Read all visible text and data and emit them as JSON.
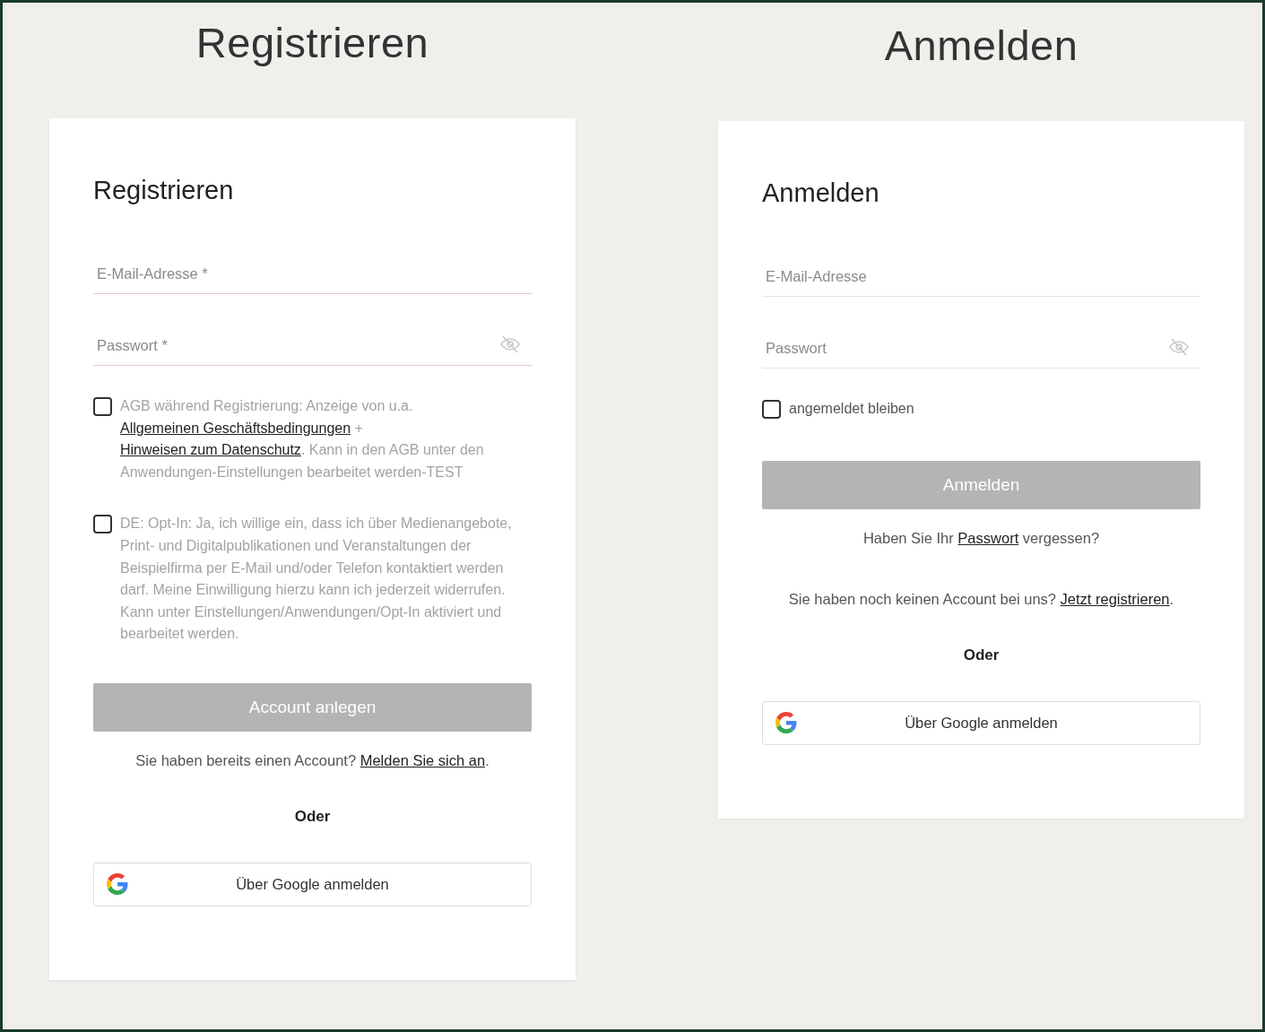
{
  "panels": [
    {
      "heading": "Registrieren",
      "card_title": "Registrieren",
      "items": [
        {
          "kind": "field",
          "placeholder": "E-Mail-Adresse *",
          "password": false,
          "invalid": true
        },
        {
          "kind": "field",
          "placeholder": "Passwort *",
          "password": true,
          "invalid": true
        },
        {
          "kind": "checkbox",
          "checked": false,
          "dark": false,
          "parts": [
            {
              "text": "AGB während Registrierung: Anzeige von u.a. ",
              "link": false
            },
            {
              "text": "Allgemeinen Geschäftsbedingungen",
              "link": true
            },
            {
              "text": " + ",
              "link": false
            },
            {
              "text": "Hinweisen zum Datenschutz",
              "link": true
            },
            {
              "text": ". Kann in den AGB unter den Anwendungen-Einstellungen bearbeitet werden-TEST",
              "link": false
            }
          ]
        },
        {
          "kind": "checkbox",
          "checked": false,
          "dark": false,
          "parts": [
            {
              "text": "DE: Opt-In: Ja, ich willige ein, dass ich über Medienangebote, Print- und Digitalpublikationen und Veranstaltungen der Beispielfirma per E-Mail und/oder Telefon kontaktiert werden darf. Meine Einwilligung hierzu kann ich jederzeit widerrufen. Kann unter Einstellungen/Anwendungen/Opt-In aktiviert und bearbeitet werden.",
              "link": false
            }
          ]
        },
        {
          "kind": "button",
          "label": "Account anlegen",
          "disabled": true
        },
        {
          "kind": "text",
          "parts": [
            {
              "text": "Sie haben bereits einen Account? ",
              "link": false
            },
            {
              "text": "Melden Sie sich an",
              "link": true
            },
            {
              "text": ".",
              "link": false
            }
          ]
        },
        {
          "kind": "separator",
          "label": "Oder"
        },
        {
          "kind": "google",
          "label": "Über Google anmelden"
        }
      ]
    },
    {
      "heading": "Anmelden",
      "card_title": "Anmelden",
      "items": [
        {
          "kind": "field",
          "placeholder": "E-Mail-Adresse",
          "password": false,
          "invalid": false
        },
        {
          "kind": "field",
          "placeholder": "Passwort",
          "password": true,
          "invalid": false
        },
        {
          "kind": "checkbox",
          "checked": false,
          "dark": true,
          "parts": [
            {
              "text": "angemeldet bleiben",
              "link": false
            }
          ]
        },
        {
          "kind": "button",
          "label": "Anmelden",
          "disabled": true
        },
        {
          "kind": "text",
          "parts": [
            {
              "text": "Haben Sie Ihr ",
              "link": false
            },
            {
              "text": "Passwort",
              "link": true
            },
            {
              "text": " vergessen?",
              "link": false
            }
          ]
        },
        {
          "kind": "text",
          "parts": [
            {
              "text": "Sie haben noch keinen Account bei uns? ",
              "link": false
            },
            {
              "text": "Jetzt registrieren",
              "link": true
            },
            {
              "text": ".",
              "link": false
            }
          ]
        },
        {
          "kind": "separator",
          "label": "Oder"
        },
        {
          "kind": "google",
          "label": "Über Google anmelden"
        }
      ]
    }
  ]
}
